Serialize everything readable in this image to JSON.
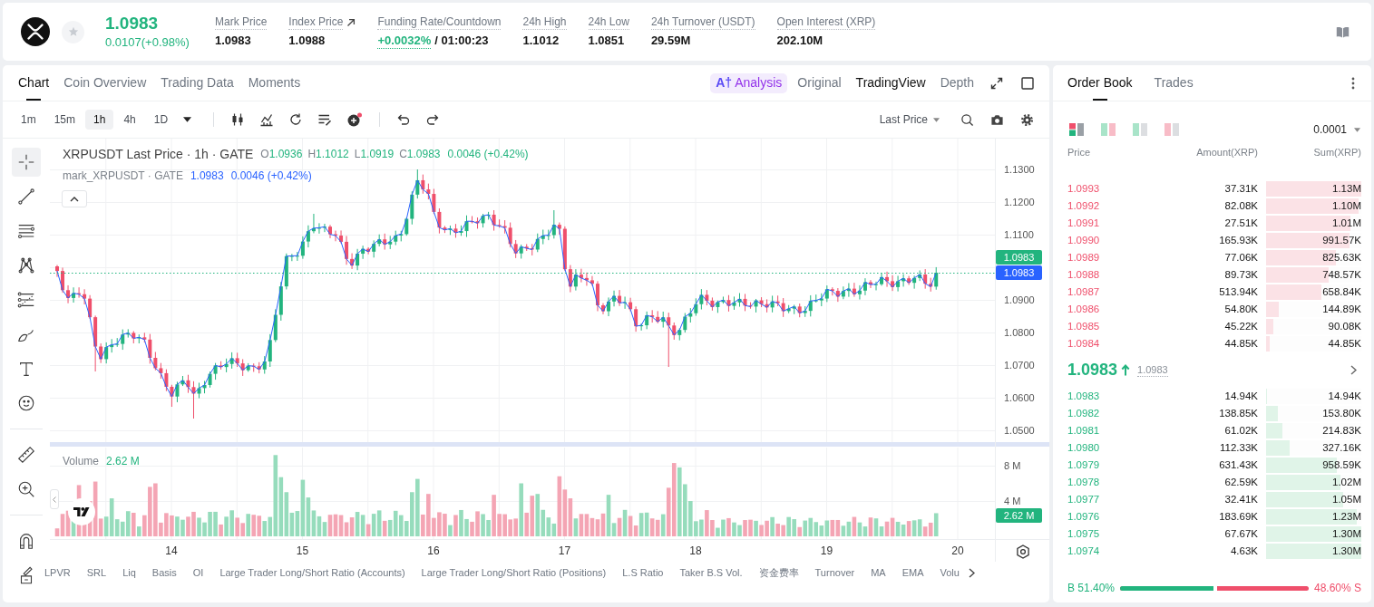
{
  "header": {
    "last_price": "1.0983",
    "change": "0.0107(+0.98%)",
    "stats": [
      {
        "kind": "plain",
        "label": "Mark Price",
        "value": "1.0983"
      },
      {
        "kind": "link",
        "label": "Index Price",
        "value": "1.0988"
      },
      {
        "kind": "funding",
        "label": "Funding Rate/Countdown",
        "value": "+0.0032%",
        "countdown": "/ 01:00:23"
      },
      {
        "kind": "plain",
        "label": "24h High",
        "value": "1.1012"
      },
      {
        "kind": "plain",
        "label": "24h Low",
        "value": "1.0851"
      },
      {
        "kind": "plain",
        "label": "24h Turnover (USDT)",
        "value": "29.59M"
      },
      {
        "kind": "plain",
        "label": "Open Interest (XRP)",
        "value": "202.10M"
      }
    ]
  },
  "chart_panel": {
    "tabs": [
      {
        "label": "Chart",
        "selected": true
      },
      {
        "label": "Coin Overview",
        "selected": false
      },
      {
        "label": "Trading Data",
        "selected": false
      },
      {
        "label": "Moments",
        "selected": false
      }
    ],
    "views": [
      {
        "kind": "ai",
        "mark": "A†",
        "label": "Analysis",
        "selected": false
      },
      {
        "kind": "plain",
        "label": "Original",
        "selected": false
      },
      {
        "kind": "plain",
        "label": "TradingView",
        "selected": true
      },
      {
        "kind": "plain",
        "label": "Depth",
        "selected": false
      }
    ],
    "intervals": [
      {
        "label": "1m",
        "selected": false
      },
      {
        "label": "15m",
        "selected": false
      },
      {
        "label": "1h",
        "selected": true
      },
      {
        "label": "4h",
        "selected": false
      },
      {
        "label": "1D",
        "selected": false
      }
    ],
    "price_source": "Last Price",
    "drawing_tools": [
      {
        "selected": true
      },
      {
        "selected": false
      },
      {
        "selected": false
      },
      {
        "selected": false
      },
      {
        "selected": false
      },
      {
        "selected": false
      },
      {
        "selected": false
      },
      {
        "selected": false
      },
      {
        "selected": false
      },
      {
        "selected": false
      },
      {
        "selected": false
      },
      {
        "selected": false
      }
    ],
    "legend": {
      "title": "XRPUSDT Last Price · 1h · GATE",
      "ohlc": [
        {
          "key": "O",
          "value": "1.0936"
        },
        {
          "key": "H",
          "value": "1.1012"
        },
        {
          "key": "L",
          "value": "1.0919"
        },
        {
          "key": "C",
          "value": "1.0983"
        }
      ],
      "change": "0.0046 (+0.42%)",
      "mark_title": "mark_XRPUSDT · GATE",
      "mark_value": "1.0983",
      "mark_change": "0.0046 (+0.42%)"
    },
    "price_axis": [
      "1.1300",
      "1.1200",
      "1.1100",
      "1.0900",
      "1.0800",
      "1.0700",
      "1.0600",
      "1.0500"
    ],
    "price_tags": [
      {
        "text": "1.0983",
        "color": "#22b47e"
      },
      {
        "text": "1.0983",
        "color": "#2962ff"
      }
    ],
    "volume": {
      "title": "Volume",
      "value": "2.62 M",
      "axis": [
        "8 M",
        "4 M"
      ],
      "tag": "2.62 M"
    },
    "time_axis": [
      "14",
      "15",
      "16",
      "17",
      "18",
      "19",
      "20"
    ],
    "indicators": [
      "LPVR",
      "SRL",
      "Liq",
      "Basis",
      "OI",
      "Large Trader Long/Short Ratio (Accounts)",
      "Large Trader Long/Short Ratio (Positions)",
      "L.S Ratio",
      "Taker B.S Vol.",
      "资金费率",
      "Turnover",
      "MA",
      "EMA",
      "Volu"
    ]
  },
  "order_book": {
    "tabs": [
      {
        "label": "Order Book",
        "selected": true
      },
      {
        "label": "Trades",
        "selected": false
      }
    ],
    "layouts": [
      {
        "selected": true
      },
      {
        "selected": false
      },
      {
        "selected": false
      },
      {
        "selected": false
      }
    ],
    "precision": "0.0001",
    "columns": [
      "Price",
      "Amount(XRP)",
      "Sum(XRP)"
    ],
    "asks": [
      {
        "price": "1.0993",
        "amount": "37.31K",
        "sum": "1.13M",
        "level": 1
      },
      {
        "price": "1.0992",
        "amount": "82.08K",
        "sum": "1.10M",
        "level": 0.97
      },
      {
        "price": "1.0991",
        "amount": "27.51K",
        "sum": "1.01M",
        "level": 0.89
      },
      {
        "price": "1.0990",
        "amount": "165.93K",
        "sum": "991.57K",
        "level": 0.88
      },
      {
        "price": "1.0989",
        "amount": "77.06K",
        "sum": "825.63K",
        "level": 0.73
      },
      {
        "price": "1.0988",
        "amount": "89.73K",
        "sum": "748.57K",
        "level": 0.66
      },
      {
        "price": "1.0987",
        "amount": "513.94K",
        "sum": "658.84K",
        "level": 0.58
      },
      {
        "price": "1.0986",
        "amount": "54.80K",
        "sum": "144.89K",
        "level": 0.13
      },
      {
        "price": "1.0985",
        "amount": "45.22K",
        "sum": "90.08K",
        "level": 0.08
      },
      {
        "price": "1.0984",
        "amount": "44.85K",
        "sum": "44.85K",
        "level": 0.04
      }
    ],
    "mid": {
      "price": "1.0983",
      "mark": "1.0983"
    },
    "bids": [
      {
        "price": "1.0983",
        "amount": "14.94K",
        "sum": "14.94K",
        "level": 0.01
      },
      {
        "price": "1.0982",
        "amount": "138.85K",
        "sum": "153.80K",
        "level": 0.12
      },
      {
        "price": "1.0981",
        "amount": "61.02K",
        "sum": "214.83K",
        "level": 0.17
      },
      {
        "price": "1.0980",
        "amount": "112.33K",
        "sum": "327.16K",
        "level": 0.25
      },
      {
        "price": "1.0979",
        "amount": "631.43K",
        "sum": "958.59K",
        "level": 0.74
      },
      {
        "price": "1.0978",
        "amount": "62.59K",
        "sum": "1.02M",
        "level": 0.78
      },
      {
        "price": "1.0977",
        "amount": "32.41K",
        "sum": "1.05M",
        "level": 0.81
      },
      {
        "price": "1.0976",
        "amount": "183.69K",
        "sum": "1.23M",
        "level": 0.95
      },
      {
        "price": "1.0975",
        "amount": "67.67K",
        "sum": "1.30M",
        "level": 1
      },
      {
        "price": "1.0974",
        "amount": "4.63K",
        "sum": "1.30M",
        "level": 1
      }
    ],
    "ratio": {
      "buy": "B 51.40%",
      "sell": "48.60% S",
      "level": 0.514
    }
  }
}
